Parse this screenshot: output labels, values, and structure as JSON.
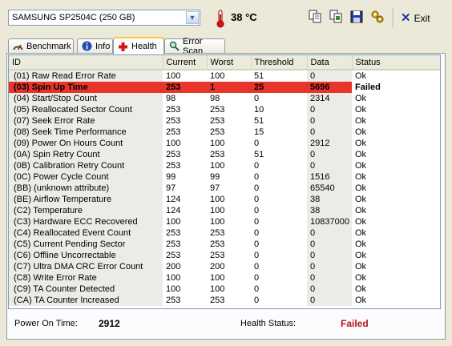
{
  "toolbar": {
    "drive_selected": "SAMSUNG SP2504C (250 GB)",
    "temperature": "38 °C",
    "exit_label": "Exit"
  },
  "tabs": [
    {
      "label": "Benchmark",
      "icon": "benchmark-icon"
    },
    {
      "label": "Info",
      "icon": "info-icon"
    },
    {
      "label": "Health",
      "icon": "health-cross-icon",
      "active": true
    },
    {
      "label": "Error Scan",
      "icon": "magnifier-icon"
    }
  ],
  "table": {
    "columns": [
      "ID",
      "Current",
      "Worst",
      "Threshold",
      "Data",
      "Status"
    ],
    "rows": [
      [
        "(01) Raw Read Error Rate",
        "100",
        "100",
        "51",
        "0",
        "Ok"
      ],
      [
        "(03) Spin Up Time",
        "253",
        "1",
        "25",
        "5696",
        "Failed"
      ],
      [
        "(04) Start/Stop Count",
        "98",
        "98",
        "0",
        "2314",
        "Ok"
      ],
      [
        "(05) Reallocated Sector Count",
        "253",
        "253",
        "10",
        "0",
        "Ok"
      ],
      [
        "(07) Seek Error Rate",
        "253",
        "253",
        "51",
        "0",
        "Ok"
      ],
      [
        "(08) Seek Time Performance",
        "253",
        "253",
        "15",
        "0",
        "Ok"
      ],
      [
        "(09) Power On Hours Count",
        "100",
        "100",
        "0",
        "2912",
        "Ok"
      ],
      [
        "(0A) Spin Retry Count",
        "253",
        "253",
        "51",
        "0",
        "Ok"
      ],
      [
        "(0B) Calibration Retry Count",
        "253",
        "100",
        "0",
        "0",
        "Ok"
      ],
      [
        "(0C) Power Cycle Count",
        "99",
        "99",
        "0",
        "1516",
        "Ok"
      ],
      [
        "(BB) (unknown attribute)",
        "97",
        "97",
        "0",
        "65540",
        "Ok"
      ],
      [
        "(BE) Airflow Temperature",
        "124",
        "100",
        "0",
        "38",
        "Ok"
      ],
      [
        "(C2) Temperature",
        "124",
        "100",
        "0",
        "38",
        "Ok"
      ],
      [
        "(C3) Hardware ECC Recovered",
        "100",
        "100",
        "0",
        "10837000",
        "Ok"
      ],
      [
        "(C4) Reallocated Event Count",
        "253",
        "253",
        "0",
        "0",
        "Ok"
      ],
      [
        "(C5) Current Pending Sector",
        "253",
        "253",
        "0",
        "0",
        "Ok"
      ],
      [
        "(C6) Offline Uncorrectable",
        "253",
        "253",
        "0",
        "0",
        "Ok"
      ],
      [
        "(C7) Ultra DMA CRC Error Count",
        "200",
        "200",
        "0",
        "0",
        "Ok"
      ],
      [
        "(C8) Write Error Rate",
        "100",
        "100",
        "0",
        "0",
        "Ok"
      ],
      [
        "(C9) TA Counter Detected",
        "100",
        "100",
        "0",
        "0",
        "Ok"
      ],
      [
        "(CA) TA Counter Increased",
        "253",
        "253",
        "0",
        "0",
        "Ok"
      ]
    ],
    "failed_row_index": 1
  },
  "footer": {
    "power_on_label": "Power On Time:",
    "power_on_value": "2912",
    "health_label": "Health Status:",
    "health_value": "Failed"
  },
  "colors": {
    "failed_row": "#e8352b",
    "failed_text": "#b3141c"
  }
}
